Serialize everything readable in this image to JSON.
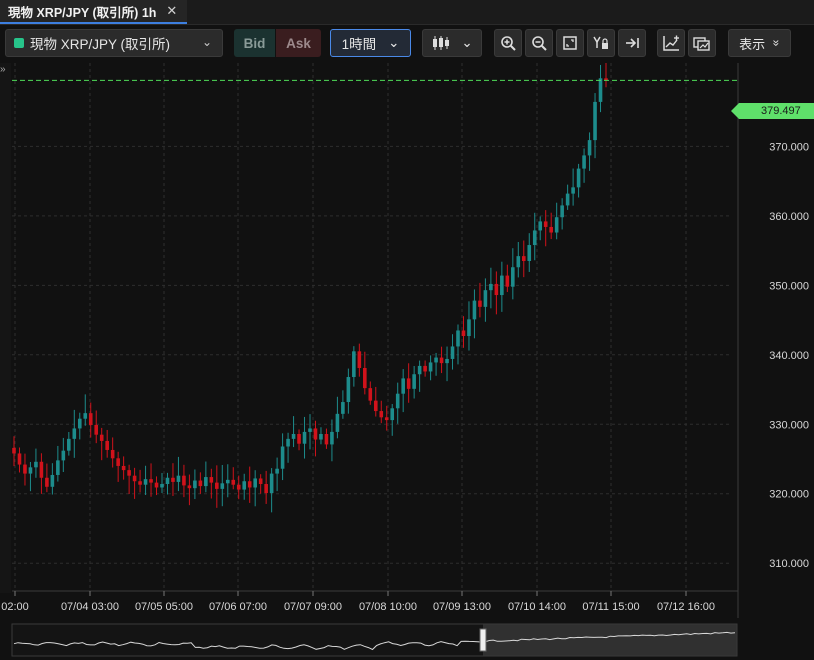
{
  "tab": {
    "title": "現物 XRP/JPY (取引所) 1h",
    "close": "✕"
  },
  "toolbar": {
    "symbol": "現物 XRP/JPY (取引所)",
    "symbol_chevron": "⌄",
    "bid": "Bid",
    "ask": "Ask",
    "interval": "1時間",
    "interval_chevron": "⌄",
    "chart_type_chevron": "⌄",
    "display": "表示",
    "display_chevron": "»"
  },
  "colors": {
    "up": "#1d8c8c",
    "down": "#d1121b",
    "grid": "#2e2e2e",
    "last_line": "#4fdc58",
    "axis_text": "#d8d8d8"
  },
  "price_axis": {
    "labels": [
      "370.000",
      "360.000",
      "350.000",
      "340.000",
      "330.000",
      "320.000",
      "310.000"
    ],
    "last_price": "379.497"
  },
  "time_axis": {
    "labels": [
      "02:00",
      "07/04 03:00",
      "07/05 05:00",
      "07/06 07:00",
      "07/07 09:00",
      "07/08 10:00",
      "07/09 13:00",
      "07/10 14:00",
      "07/11 15:00",
      "07/12 16:00"
    ]
  },
  "chart_data": {
    "type": "candlestick",
    "ylim": [
      306,
      382
    ],
    "last": 379.497,
    "series_close": [
      325.8,
      324.2,
      322.9,
      323.8,
      324.6,
      322.3,
      321.0,
      322.7,
      324.8,
      326.2,
      327.9,
      329.4,
      330.8,
      331.6,
      329.9,
      328.5,
      327.6,
      326.3,
      325.1,
      324.0,
      323.4,
      322.6,
      321.8,
      321.3,
      322.1,
      321.6,
      320.9,
      321.4,
      322.3,
      321.7,
      322.6,
      321.2,
      320.8,
      321.9,
      321.1,
      322.4,
      321.6,
      320.7,
      321.5,
      322.0,
      321.3,
      320.6,
      321.8,
      320.9,
      322.2,
      321.4,
      320.1,
      322.9,
      323.6,
      326.8,
      327.9,
      328.6,
      327.2,
      328.9,
      329.4,
      327.8,
      328.6,
      327.1,
      328.9,
      331.5,
      333.2,
      336.8,
      340.5,
      338.1,
      335.2,
      333.4,
      331.9,
      331.0,
      330.6,
      332.3,
      334.4,
      336.6,
      335.1,
      337.2,
      338.4,
      337.6,
      338.9,
      339.6,
      338.8,
      339.4,
      341.2,
      343.5,
      342.7,
      345.1,
      347.8,
      346.9,
      349.3,
      350.2,
      348.6,
      351.4,
      349.8,
      352.6,
      354.2,
      353.5,
      355.8,
      357.9,
      359.2,
      358.4,
      357.6,
      359.8,
      361.5,
      363.2,
      364.1,
      366.8,
      368.7,
      370.9,
      376.4,
      379.8,
      379.5
    ]
  }
}
